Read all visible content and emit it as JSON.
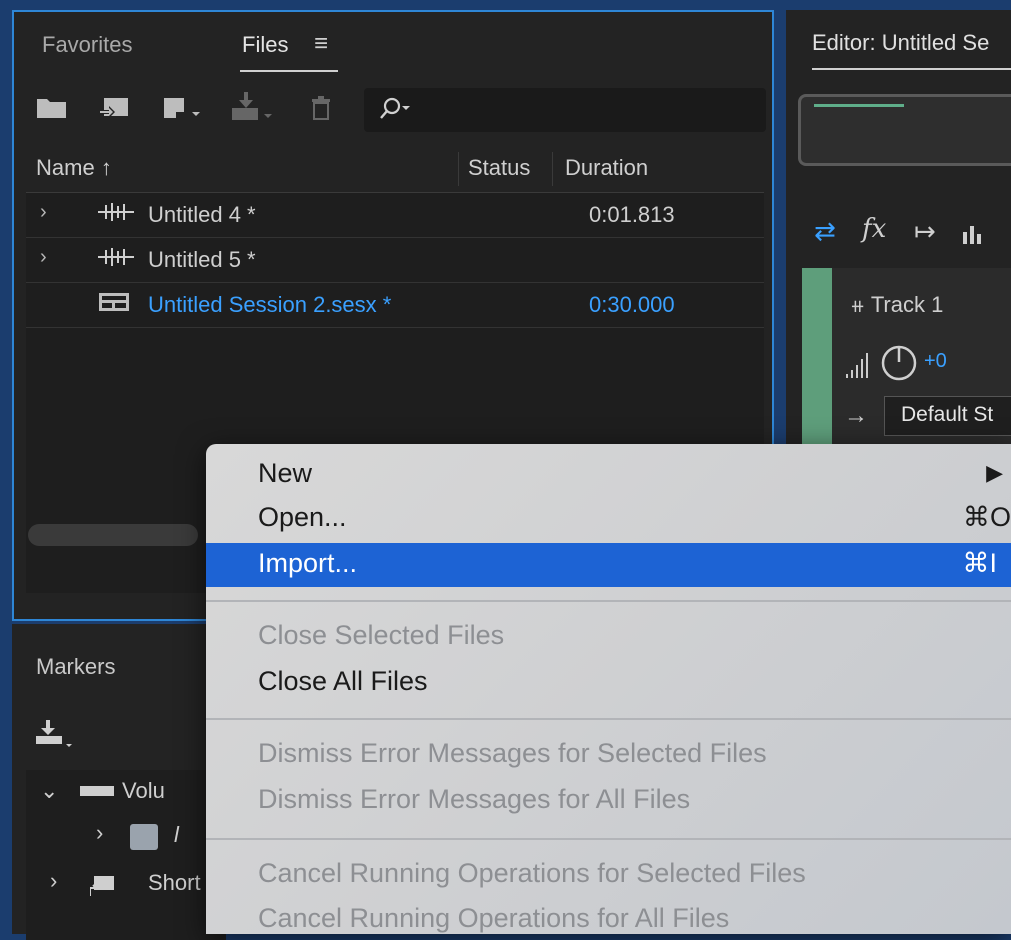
{
  "files_panel": {
    "tabs": [
      {
        "label": "Favorites"
      },
      {
        "label": "Files"
      }
    ],
    "menu_icon": "hamburger-menu-icon",
    "columns": {
      "name": "Name",
      "sort_arrow": "↑",
      "status": "Status",
      "duration": "Duration"
    },
    "rows": [
      {
        "name": "Untitled 4 *",
        "duration": "0:01.813",
        "icon": "waveform-icon",
        "expandable": true
      },
      {
        "name": "Untitled 5 *",
        "duration": "",
        "icon": "waveform-icon",
        "expandable": true
      },
      {
        "name": "Untitled Session 2.sesx *",
        "duration": "0:30.000",
        "icon": "multitrack-session-icon",
        "expandable": false,
        "selected": true
      }
    ]
  },
  "editor_panel": {
    "title": "Editor: Untitled Se",
    "track": {
      "name": "Track 1",
      "volume": "+0",
      "output": "Default St"
    }
  },
  "markers_panel": {
    "title": "Markers",
    "tree": [
      {
        "label": "Volu"
      },
      {
        "label": "l"
      },
      {
        "label": "Short"
      }
    ]
  },
  "context_menu": {
    "items": [
      {
        "label": "New",
        "shortcut": "▶",
        "disabled": false
      },
      {
        "label": "Open...",
        "shortcut": "⌘O",
        "disabled": false
      },
      {
        "label": "Import...",
        "shortcut": "⌘I",
        "disabled": false,
        "highlighted": true
      },
      {
        "label": "Close Selected Files",
        "shortcut": "",
        "disabled": true
      },
      {
        "label": "Close All Files",
        "shortcut": "",
        "disabled": false
      },
      {
        "label": "Dismiss Error Messages for Selected Files",
        "shortcut": "",
        "disabled": true
      },
      {
        "label": "Dismiss Error Messages for All Files",
        "shortcut": "",
        "disabled": true
      },
      {
        "label": "Cancel Running Operations for Selected Files",
        "shortcut": "",
        "disabled": true
      },
      {
        "label": "Cancel Running Operations for All Files",
        "shortcut": "",
        "disabled": true
      }
    ]
  },
  "colors": {
    "accent": "#2e86d6",
    "selected_text": "#3aa0ff",
    "menu_highlight": "#1d63d4",
    "track_strip": "#5e9e7b"
  }
}
